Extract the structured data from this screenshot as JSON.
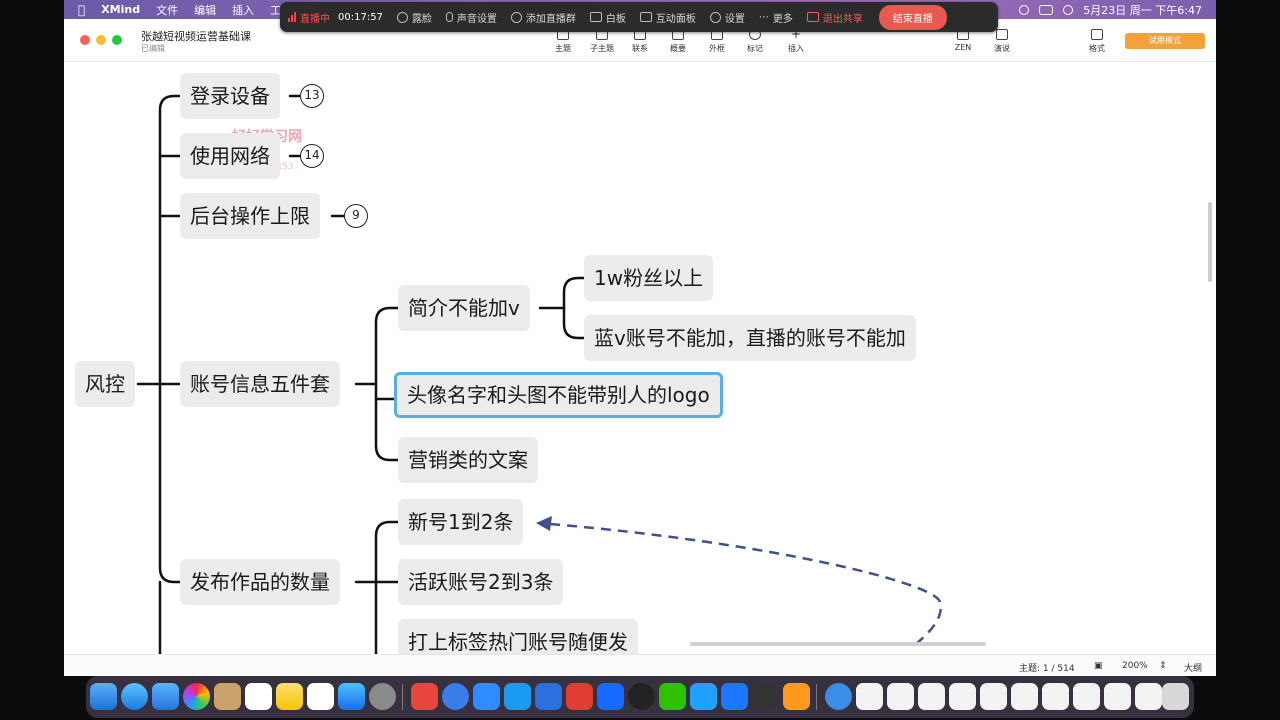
{
  "menubar": {
    "app_name": "XMind",
    "items": [
      "文件",
      "编辑",
      "插入",
      "工"
    ],
    "datetime": "5月23日 周一 下午6:47"
  },
  "livebar": {
    "status": "直播中",
    "timer": "00:17:57",
    "items": [
      "露脸",
      "声音设置",
      "添加直播群",
      "白板",
      "互动面板",
      "设置",
      "更多"
    ],
    "exit_share": "退出共享",
    "end_live": "结束直播"
  },
  "window": {
    "title": "张越短视频运营基础课",
    "subtitle": "已编辑",
    "toolbar": [
      "主题",
      "子主题",
      "联系",
      "概要",
      "外框",
      "标记",
      "插入"
    ],
    "toolbar_right": [
      "ZEN",
      "演说"
    ],
    "format": "格式",
    "trial": "试用模式"
  },
  "watermark": {
    "main": "好好学习网",
    "sub": "更多一手课程微信53"
  },
  "mindmap": {
    "root": "风控",
    "branches": [
      {
        "label": "登录设备",
        "count": "13"
      },
      {
        "label": "使用网络",
        "count": "14"
      },
      {
        "label": "后台操作上限",
        "count": "9"
      },
      {
        "label": "账号信息五件套"
      },
      {
        "label": "发布作品的数量"
      }
    ],
    "profile_children": [
      "简介不能加v",
      "头像名字和头图不能带别人的logo",
      "营销类的文案"
    ],
    "bio_children": [
      "1w粉丝以上",
      "蓝v账号不能加，直播的账号不能加"
    ],
    "post_children": [
      "新号1到2条",
      "活跃账号2到3条",
      "打上标签热门账号随便发"
    ]
  },
  "statusbar": {
    "topic_count": "主题: 1 / 514",
    "zoom": "200%",
    "outline": "大纲"
  },
  "colors": {
    "selected_border": "#5aaee8",
    "relationship_line": "#3f4f8f",
    "topic_bg": "#ececec"
  }
}
